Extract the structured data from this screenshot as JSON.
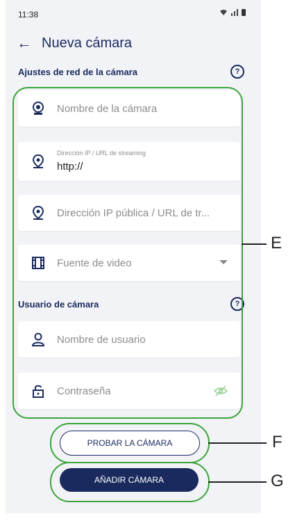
{
  "status_bar": {
    "time": "11:38"
  },
  "header": {
    "title": "Nueva cámara"
  },
  "network_section": {
    "title": "Ajustes de red de la cámara",
    "fields": [
      {
        "icon": "webcam-icon",
        "placeholder": "Nombre de la cámara"
      },
      {
        "icon": "location-pin-icon",
        "label": "Dirección IP / URL de streaming",
        "value": "http://"
      },
      {
        "icon": "location-pin-icon",
        "placeholder": "Dirección IP pública / URL de tr..."
      },
      {
        "icon": "film-icon",
        "placeholder": "Fuente de video"
      }
    ]
  },
  "user_section": {
    "title": "Usuario de cámara",
    "fields": [
      {
        "icon": "user-icon",
        "placeholder": "Nombre de usuario"
      },
      {
        "icon": "lock-icon",
        "placeholder": "Contraseña"
      }
    ]
  },
  "buttons": {
    "test": "PROBAR LA CÁMARA",
    "add": "AÑADIR CÁMARA"
  },
  "callouts": {
    "e": "E",
    "f": "F",
    "g": "G"
  },
  "colors": {
    "navy": "#1a2a5e",
    "highlight": "#3aa53a",
    "background": "#f2f3f7"
  }
}
